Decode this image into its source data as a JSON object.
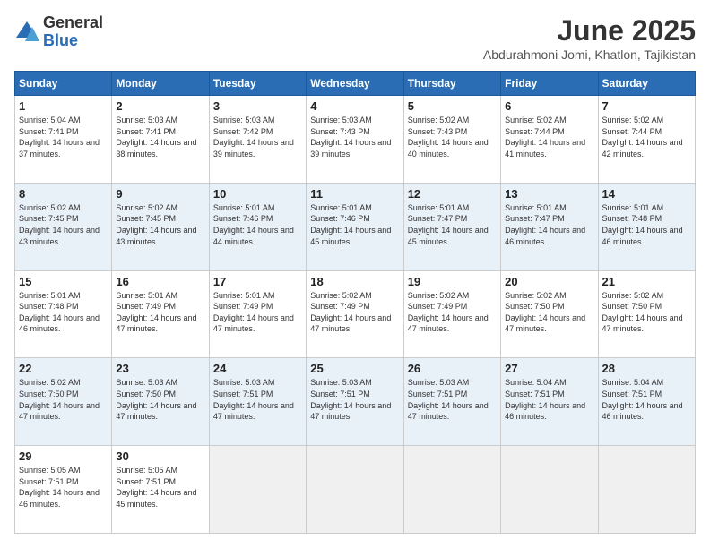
{
  "logo": {
    "general": "General",
    "blue": "Blue"
  },
  "title": "June 2025",
  "location": "Abdurahmoni Jomi, Khatlon, Tajikistan",
  "headers": [
    "Sunday",
    "Monday",
    "Tuesday",
    "Wednesday",
    "Thursday",
    "Friday",
    "Saturday"
  ],
  "weeks": [
    [
      {
        "day": "1",
        "sunrise": "5:04 AM",
        "sunset": "7:41 PM",
        "daylight": "14 hours and 37 minutes."
      },
      {
        "day": "2",
        "sunrise": "5:03 AM",
        "sunset": "7:41 PM",
        "daylight": "14 hours and 38 minutes."
      },
      {
        "day": "3",
        "sunrise": "5:03 AM",
        "sunset": "7:42 PM",
        "daylight": "14 hours and 39 minutes."
      },
      {
        "day": "4",
        "sunrise": "5:03 AM",
        "sunset": "7:43 PM",
        "daylight": "14 hours and 39 minutes."
      },
      {
        "day": "5",
        "sunrise": "5:02 AM",
        "sunset": "7:43 PM",
        "daylight": "14 hours and 40 minutes."
      },
      {
        "day": "6",
        "sunrise": "5:02 AM",
        "sunset": "7:44 PM",
        "daylight": "14 hours and 41 minutes."
      },
      {
        "day": "7",
        "sunrise": "5:02 AM",
        "sunset": "7:44 PM",
        "daylight": "14 hours and 42 minutes."
      }
    ],
    [
      {
        "day": "8",
        "sunrise": "5:02 AM",
        "sunset": "7:45 PM",
        "daylight": "14 hours and 43 minutes."
      },
      {
        "day": "9",
        "sunrise": "5:02 AM",
        "sunset": "7:45 PM",
        "daylight": "14 hours and 43 minutes."
      },
      {
        "day": "10",
        "sunrise": "5:01 AM",
        "sunset": "7:46 PM",
        "daylight": "14 hours and 44 minutes."
      },
      {
        "day": "11",
        "sunrise": "5:01 AM",
        "sunset": "7:46 PM",
        "daylight": "14 hours and 45 minutes."
      },
      {
        "day": "12",
        "sunrise": "5:01 AM",
        "sunset": "7:47 PM",
        "daylight": "14 hours and 45 minutes."
      },
      {
        "day": "13",
        "sunrise": "5:01 AM",
        "sunset": "7:47 PM",
        "daylight": "14 hours and 46 minutes."
      },
      {
        "day": "14",
        "sunrise": "5:01 AM",
        "sunset": "7:48 PM",
        "daylight": "14 hours and 46 minutes."
      }
    ],
    [
      {
        "day": "15",
        "sunrise": "5:01 AM",
        "sunset": "7:48 PM",
        "daylight": "14 hours and 46 minutes."
      },
      {
        "day": "16",
        "sunrise": "5:01 AM",
        "sunset": "7:49 PM",
        "daylight": "14 hours and 47 minutes."
      },
      {
        "day": "17",
        "sunrise": "5:01 AM",
        "sunset": "7:49 PM",
        "daylight": "14 hours and 47 minutes."
      },
      {
        "day": "18",
        "sunrise": "5:02 AM",
        "sunset": "7:49 PM",
        "daylight": "14 hours and 47 minutes."
      },
      {
        "day": "19",
        "sunrise": "5:02 AM",
        "sunset": "7:49 PM",
        "daylight": "14 hours and 47 minutes."
      },
      {
        "day": "20",
        "sunrise": "5:02 AM",
        "sunset": "7:50 PM",
        "daylight": "14 hours and 47 minutes."
      },
      {
        "day": "21",
        "sunrise": "5:02 AM",
        "sunset": "7:50 PM",
        "daylight": "14 hours and 47 minutes."
      }
    ],
    [
      {
        "day": "22",
        "sunrise": "5:02 AM",
        "sunset": "7:50 PM",
        "daylight": "14 hours and 47 minutes."
      },
      {
        "day": "23",
        "sunrise": "5:03 AM",
        "sunset": "7:50 PM",
        "daylight": "14 hours and 47 minutes."
      },
      {
        "day": "24",
        "sunrise": "5:03 AM",
        "sunset": "7:51 PM",
        "daylight": "14 hours and 47 minutes."
      },
      {
        "day": "25",
        "sunrise": "5:03 AM",
        "sunset": "7:51 PM",
        "daylight": "14 hours and 47 minutes."
      },
      {
        "day": "26",
        "sunrise": "5:03 AM",
        "sunset": "7:51 PM",
        "daylight": "14 hours and 47 minutes."
      },
      {
        "day": "27",
        "sunrise": "5:04 AM",
        "sunset": "7:51 PM",
        "daylight": "14 hours and 46 minutes."
      },
      {
        "day": "28",
        "sunrise": "5:04 AM",
        "sunset": "7:51 PM",
        "daylight": "14 hours and 46 minutes."
      }
    ],
    [
      {
        "day": "29",
        "sunrise": "5:05 AM",
        "sunset": "7:51 PM",
        "daylight": "14 hours and 46 minutes."
      },
      {
        "day": "30",
        "sunrise": "5:05 AM",
        "sunset": "7:51 PM",
        "daylight": "14 hours and 45 minutes."
      },
      null,
      null,
      null,
      null,
      null
    ]
  ]
}
